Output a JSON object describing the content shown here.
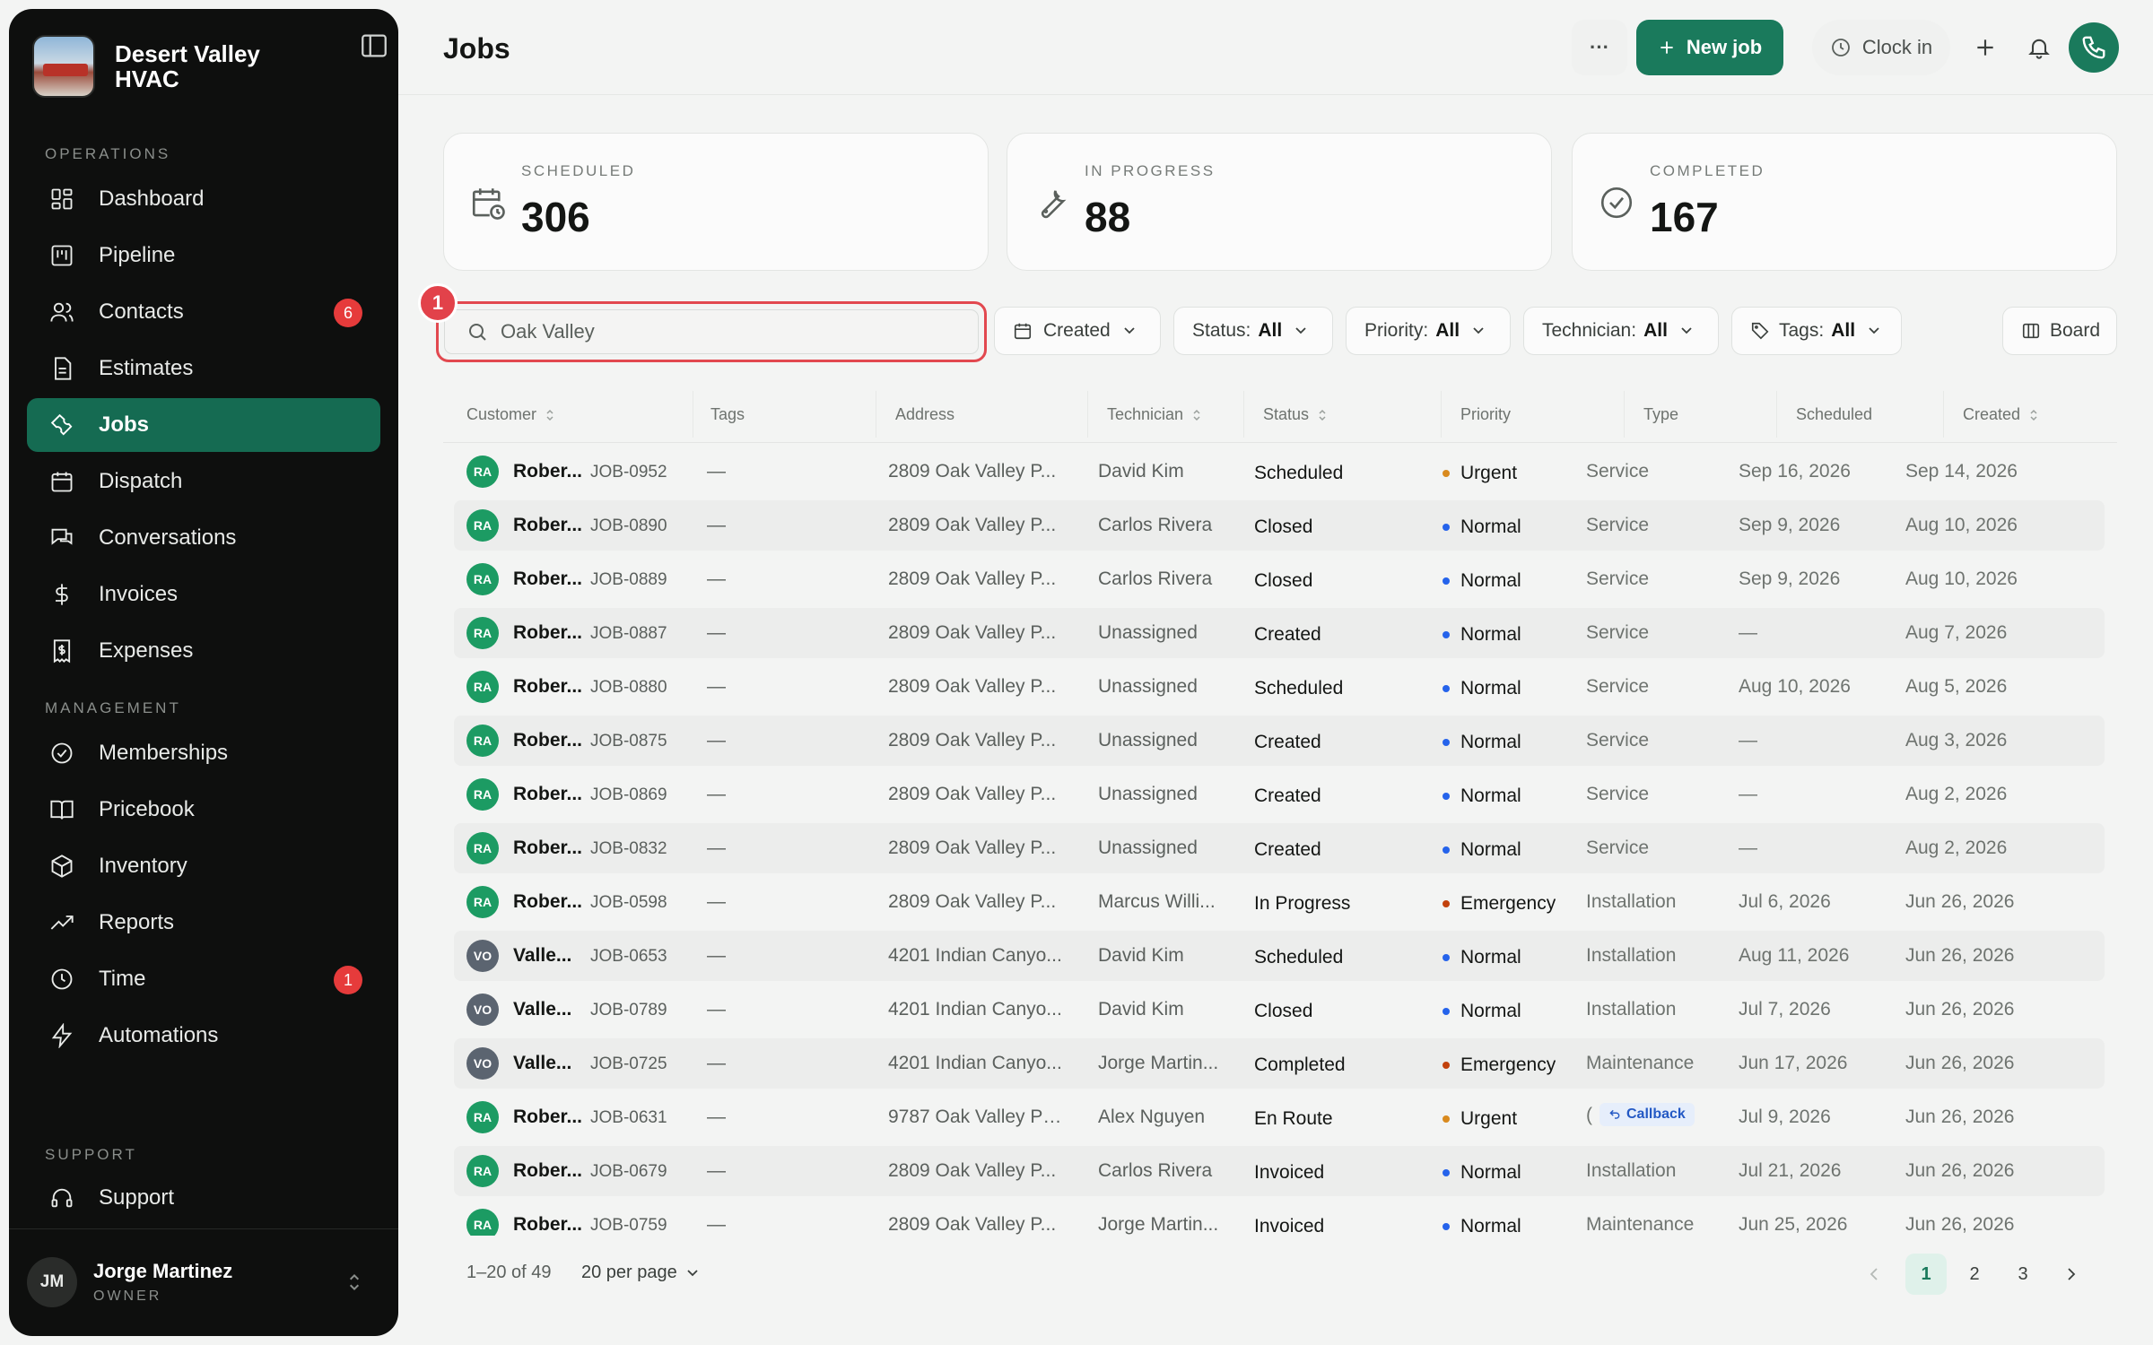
{
  "sidebar": {
    "brand": {
      "name": "Desert Valley HVAC"
    },
    "sections": {
      "operations": "OPERATIONS",
      "management": "MANAGEMENT",
      "support": "SUPPORT"
    },
    "items": [
      {
        "label": "Dashboard",
        "icon": "dashboard-icon"
      },
      {
        "label": "Pipeline",
        "icon": "pipeline-icon"
      },
      {
        "label": "Contacts",
        "icon": "contacts-icon",
        "badge": "6"
      },
      {
        "label": "Estimates",
        "icon": "estimates-icon"
      },
      {
        "label": "Jobs",
        "icon": "wrench-icon",
        "active": true
      },
      {
        "label": "Dispatch",
        "icon": "calendar-icon"
      },
      {
        "label": "Conversations",
        "icon": "chat-icon"
      },
      {
        "label": "Invoices",
        "icon": "dollar-icon"
      },
      {
        "label": "Expenses",
        "icon": "receipt-icon"
      },
      {
        "label": "Memberships",
        "icon": "badge-check-icon"
      },
      {
        "label": "Pricebook",
        "icon": "book-icon"
      },
      {
        "label": "Inventory",
        "icon": "box-icon"
      },
      {
        "label": "Reports",
        "icon": "trend-icon"
      },
      {
        "label": "Time",
        "icon": "clock-icon",
        "badge": "1"
      },
      {
        "label": "Automations",
        "icon": "bolt-icon"
      },
      {
        "label": "Support",
        "icon": "headset-icon"
      }
    ],
    "user": {
      "initials": "JM",
      "name": "Jorge Martinez",
      "role": "OWNER"
    }
  },
  "header": {
    "title": "Jobs",
    "more_label": "···",
    "new_job_label": "New job",
    "clock_in_label": "Clock in"
  },
  "stats": [
    {
      "label": "SCHEDULED",
      "value": "306",
      "icon": "calendar-clock-icon"
    },
    {
      "label": "IN PROGRESS",
      "value": "88",
      "icon": "wrench-icon"
    },
    {
      "label": "COMPLETED",
      "value": "167",
      "icon": "check-circle-icon"
    }
  ],
  "toolbar": {
    "step_badge": "1",
    "search_value": "Oak Valley",
    "created_label": "Created",
    "status": {
      "label": "Status:",
      "value": "All"
    },
    "priority": {
      "label": "Priority:",
      "value": "All"
    },
    "technician": {
      "label": "Technician:",
      "value": "All"
    },
    "tags": {
      "label": "Tags:",
      "value": "All"
    },
    "board_label": "Board"
  },
  "table": {
    "columns": [
      "Customer",
      "Tags",
      "Address",
      "Technician",
      "Status",
      "Priority",
      "Type",
      "Scheduled",
      "Created"
    ],
    "rows": [
      {
        "initials": "RA",
        "customer": "Rober...",
        "job": "JOB-0952",
        "tags": "—",
        "address": "2809 Oak Valley P...",
        "tech": "David Kim",
        "status": "Scheduled",
        "priority": "Urgent",
        "type": "Service",
        "scheduled": "Sep 16, 2026",
        "created": "Sep 14, 2026"
      },
      {
        "initials": "RA",
        "customer": "Rober...",
        "job": "JOB-0890",
        "tags": "—",
        "address": "2809 Oak Valley P...",
        "tech": "Carlos Rivera",
        "status": "Closed",
        "priority": "Normal",
        "type": "Service",
        "scheduled": "Sep 9, 2026",
        "created": "Aug 10, 2026"
      },
      {
        "initials": "RA",
        "customer": "Rober...",
        "job": "JOB-0889",
        "tags": "—",
        "address": "2809 Oak Valley P...",
        "tech": "Carlos Rivera",
        "status": "Closed",
        "priority": "Normal",
        "type": "Service",
        "scheduled": "Sep 9, 2026",
        "created": "Aug 10, 2026"
      },
      {
        "initials": "RA",
        "customer": "Rober...",
        "job": "JOB-0887",
        "tags": "—",
        "address": "2809 Oak Valley P...",
        "tech": "Unassigned",
        "status": "Created",
        "priority": "Normal",
        "type": "Service",
        "scheduled": "—",
        "created": "Aug 7, 2026"
      },
      {
        "initials": "RA",
        "customer": "Rober...",
        "job": "JOB-0880",
        "tags": "—",
        "address": "2809 Oak Valley P...",
        "tech": "Unassigned",
        "status": "Scheduled",
        "priority": "Normal",
        "type": "Service",
        "scheduled": "Aug 10, 2026",
        "created": "Aug 5, 2026"
      },
      {
        "initials": "RA",
        "customer": "Rober...",
        "job": "JOB-0875",
        "tags": "—",
        "address": "2809 Oak Valley P...",
        "tech": "Unassigned",
        "status": "Created",
        "priority": "Normal",
        "type": "Service",
        "scheduled": "—",
        "created": "Aug 3, 2026"
      },
      {
        "initials": "RA",
        "customer": "Rober...",
        "job": "JOB-0869",
        "tags": "—",
        "address": "2809 Oak Valley P...",
        "tech": "Unassigned",
        "status": "Created",
        "priority": "Normal",
        "type": "Service",
        "scheduled": "—",
        "created": "Aug 2, 2026"
      },
      {
        "initials": "RA",
        "customer": "Rober...",
        "job": "JOB-0832",
        "tags": "—",
        "address": "2809 Oak Valley P...",
        "tech": "Unassigned",
        "status": "Created",
        "priority": "Normal",
        "type": "Service",
        "scheduled": "—",
        "created": "Aug 2, 2026"
      },
      {
        "initials": "RA",
        "customer": "Rober...",
        "job": "JOB-0598",
        "tags": "—",
        "address": "2809 Oak Valley P...",
        "tech": "Marcus Willi...",
        "status": "In Progress",
        "priority": "Emergency",
        "type": "Installation",
        "scheduled": "Jul 6, 2026",
        "created": "Jun 26, 2026"
      },
      {
        "initials": "VO",
        "customer": "Valle...",
        "job": "JOB-0653",
        "tags": "—",
        "address": "4201 Indian Canyo...",
        "tech": "David Kim",
        "status": "Scheduled",
        "priority": "Normal",
        "type": "Installation",
        "scheduled": "Aug 11, 2026",
        "created": "Jun 26, 2026"
      },
      {
        "initials": "VO",
        "customer": "Valle...",
        "job": "JOB-0789",
        "tags": "—",
        "address": "4201 Indian Canyo...",
        "tech": "David Kim",
        "status": "Closed",
        "priority": "Normal",
        "type": "Installation",
        "scheduled": "Jul 7, 2026",
        "created": "Jun 26, 2026"
      },
      {
        "initials": "VO",
        "customer": "Valle...",
        "job": "JOB-0725",
        "tags": "—",
        "address": "4201 Indian Canyo...",
        "tech": "Jorge Martin...",
        "status": "Completed",
        "priority": "Emergency",
        "type": "Maintenance",
        "scheduled": "Jun 17, 2026",
        "created": "Jun 26, 2026"
      },
      {
        "initials": "RA",
        "customer": "Rober...",
        "job": "JOB-0631",
        "tags": "—",
        "address": "9787 Oak Valley Pk...",
        "tech": "Alex Nguyen",
        "status": "En Route",
        "priority": "Urgent",
        "type": "(",
        "type_tag": "Callback",
        "scheduled": "Jul 9, 2026",
        "created": "Jun 26, 2026"
      },
      {
        "initials": "RA",
        "customer": "Rober...",
        "job": "JOB-0679",
        "tags": "—",
        "address": "2809 Oak Valley P...",
        "tech": "Carlos Rivera",
        "status": "Invoiced",
        "priority": "Normal",
        "type": "Installation",
        "scheduled": "Jul 21, 2026",
        "created": "Jun 26, 2026"
      },
      {
        "initials": "RA",
        "customer": "Rober...",
        "job": "JOB-0759",
        "tags": "—",
        "address": "2809 Oak Valley P...",
        "tech": "Jorge Martin...",
        "status": "Invoiced",
        "priority": "Normal",
        "type": "Maintenance",
        "scheduled": "Jun 25, 2026",
        "created": "Jun 26, 2026"
      }
    ]
  },
  "footer": {
    "range": "1–20 of 49",
    "per_page": "20 per page",
    "pages": [
      "1",
      "2",
      "3"
    ],
    "current_page": "1"
  },
  "colors": {
    "accent": "#1a7a5c",
    "urgent": "#d98a1e",
    "emergency": "#c2410c",
    "normal": "#2563eb",
    "highlight": "#e2484f"
  }
}
